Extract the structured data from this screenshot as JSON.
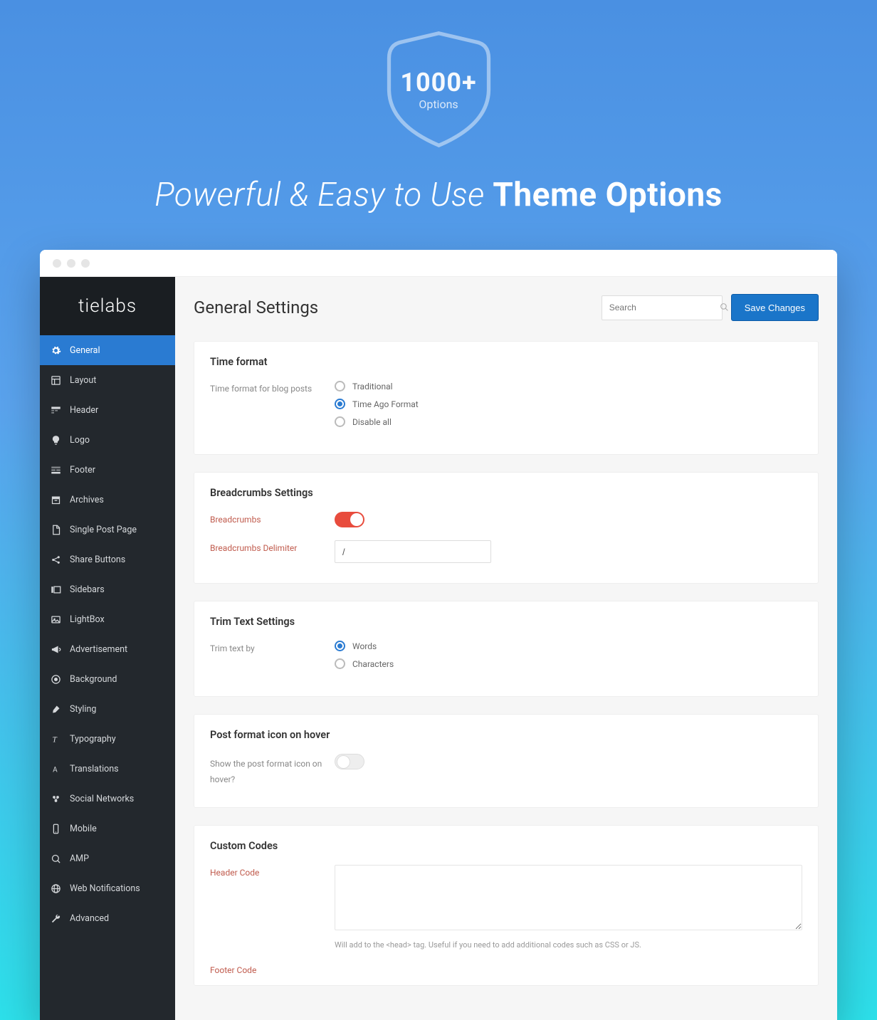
{
  "hero": {
    "shield_number": "1000+",
    "shield_label": "Options",
    "tagline_light": "Powerful & Easy to Use ",
    "tagline_strong": "Theme Options"
  },
  "logo": "tielabs",
  "sidebar": {
    "items": [
      {
        "label": "General",
        "icon": "gear",
        "active": true
      },
      {
        "label": "Layout",
        "icon": "layout"
      },
      {
        "label": "Header",
        "icon": "header"
      },
      {
        "label": "Logo",
        "icon": "bulb"
      },
      {
        "label": "Footer",
        "icon": "footer"
      },
      {
        "label": "Archives",
        "icon": "archive"
      },
      {
        "label": "Single Post Page",
        "icon": "page"
      },
      {
        "label": "Share Buttons",
        "icon": "share"
      },
      {
        "label": "Sidebars",
        "icon": "sidebars"
      },
      {
        "label": "LightBox",
        "icon": "lightbox"
      },
      {
        "label": "Advertisement",
        "icon": "megaphone"
      },
      {
        "label": "Background",
        "icon": "background"
      },
      {
        "label": "Styling",
        "icon": "brush"
      },
      {
        "label": "Typography",
        "icon": "typography"
      },
      {
        "label": "Translations",
        "icon": "translate"
      },
      {
        "label": "Social Networks",
        "icon": "social"
      },
      {
        "label": "Mobile",
        "icon": "mobile"
      },
      {
        "label": "AMP",
        "icon": "amp"
      },
      {
        "label": "Web Notifications",
        "icon": "globe"
      },
      {
        "label": "Advanced",
        "icon": "wrench"
      }
    ]
  },
  "header": {
    "title": "General Settings",
    "search_placeholder": "Search",
    "save_label": "Save Changes"
  },
  "sections": {
    "time": {
      "title": "Time format",
      "row_label": "Time format for blog posts",
      "options": [
        "Traditional",
        "Time Ago Format",
        "Disable all"
      ],
      "selected_index": 1
    },
    "breadcrumbs": {
      "title": "Breadcrumbs Settings",
      "toggle_label": "Breadcrumbs",
      "toggle_on": true,
      "delimiter_label": "Breadcrumbs Delimiter",
      "delimiter_value": "/"
    },
    "trim": {
      "title": "Trim Text Settings",
      "row_label": "Trim text by",
      "options": [
        "Words",
        "Characters"
      ],
      "selected_index": 0
    },
    "posticon": {
      "title": "Post format icon on hover",
      "row_label": "Show the post format icon on hover?",
      "toggle_on": false
    },
    "custom": {
      "title": "Custom Codes",
      "header_code_label": "Header Code",
      "header_code_value": "",
      "header_code_hint": "Will add to the <head> tag. Useful if you need to add additional codes such as CSS or JS.",
      "footer_code_label": "Footer Code"
    }
  }
}
